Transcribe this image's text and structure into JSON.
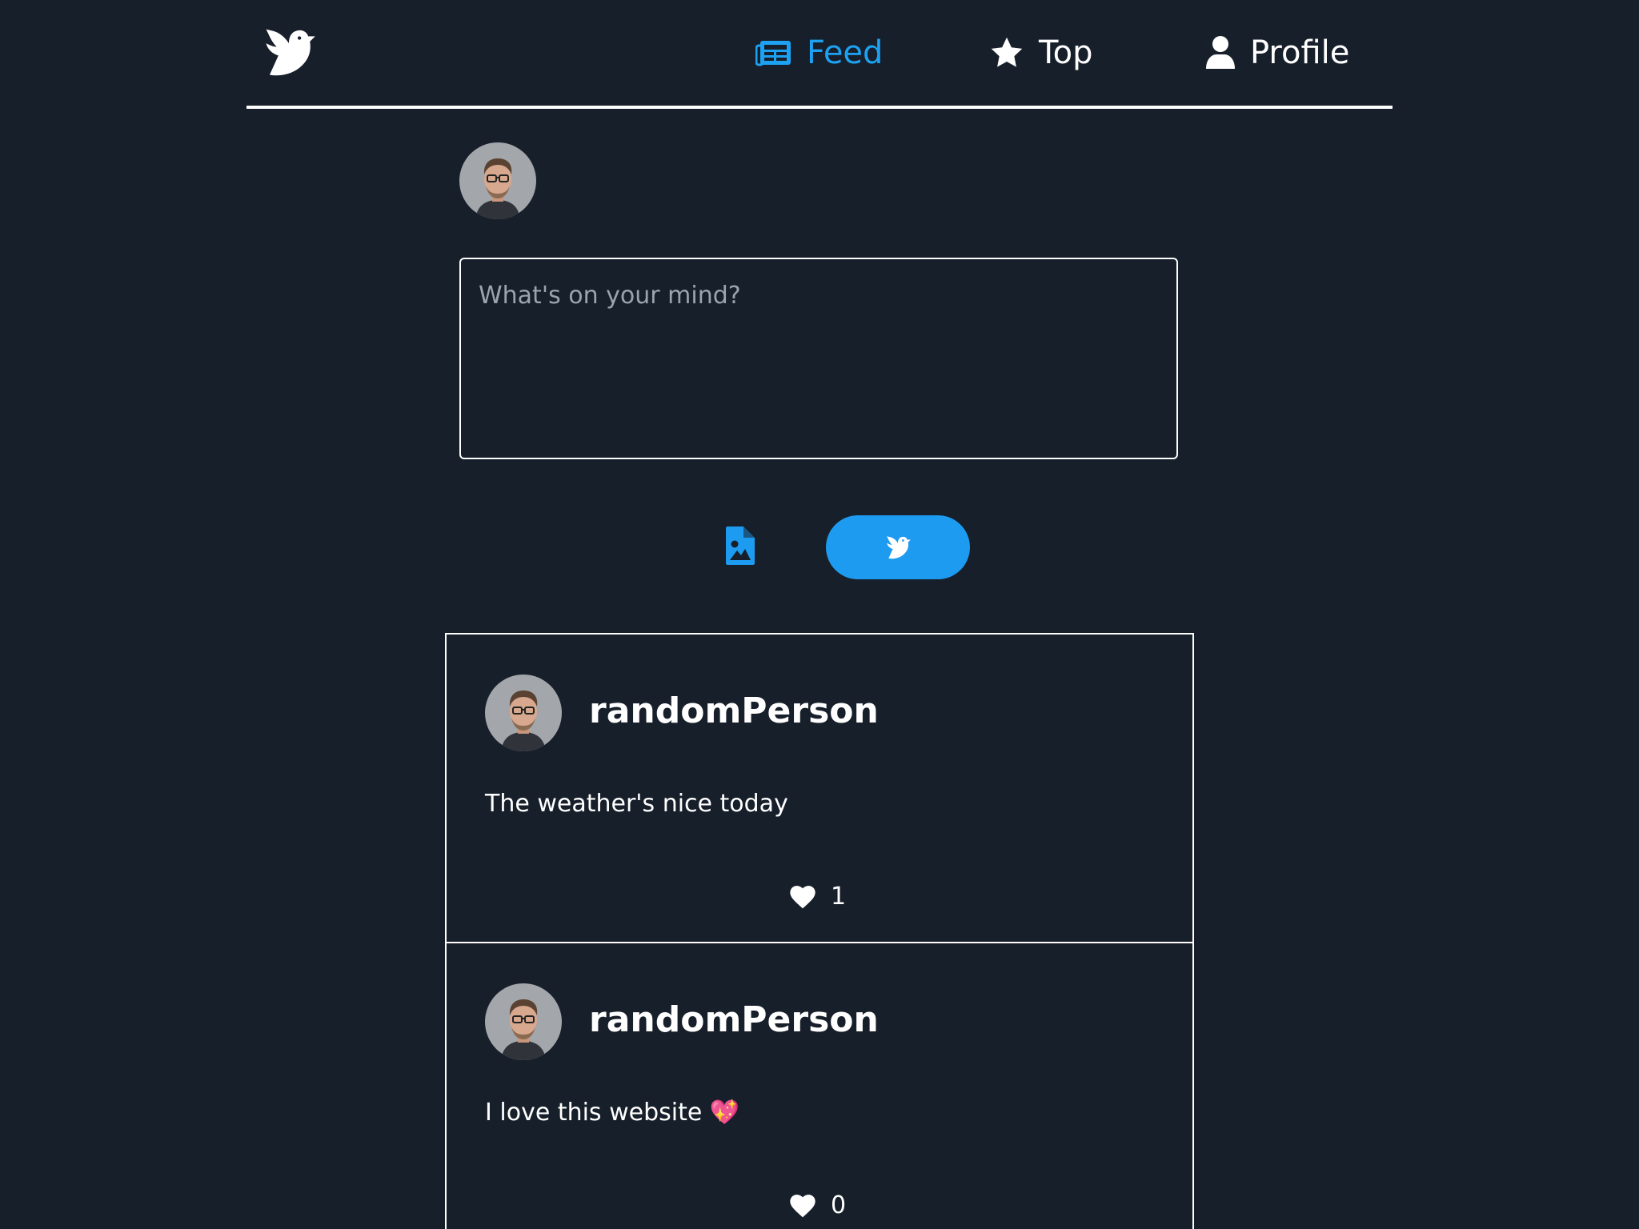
{
  "nav": {
    "logo_icon": "dove-icon",
    "items": [
      {
        "label": "Feed",
        "icon": "newspaper-icon",
        "active": true
      },
      {
        "label": "Top",
        "icon": "star-icon",
        "active": false
      },
      {
        "label": "Profile",
        "icon": "user-icon",
        "active": false
      }
    ]
  },
  "composer": {
    "placeholder": "What's on your mind?",
    "value": "",
    "image_icon": "image-file-icon",
    "post_icon": "dove-icon"
  },
  "posts": [
    {
      "username": "randomPerson",
      "text": "The weather's nice today",
      "likes": "1"
    },
    {
      "username": "randomPerson",
      "text": "I love this website 💖",
      "likes": "0"
    }
  ],
  "colors": {
    "background": "#171f2a",
    "accent": "#1da1f2",
    "text": "#ffffff"
  }
}
